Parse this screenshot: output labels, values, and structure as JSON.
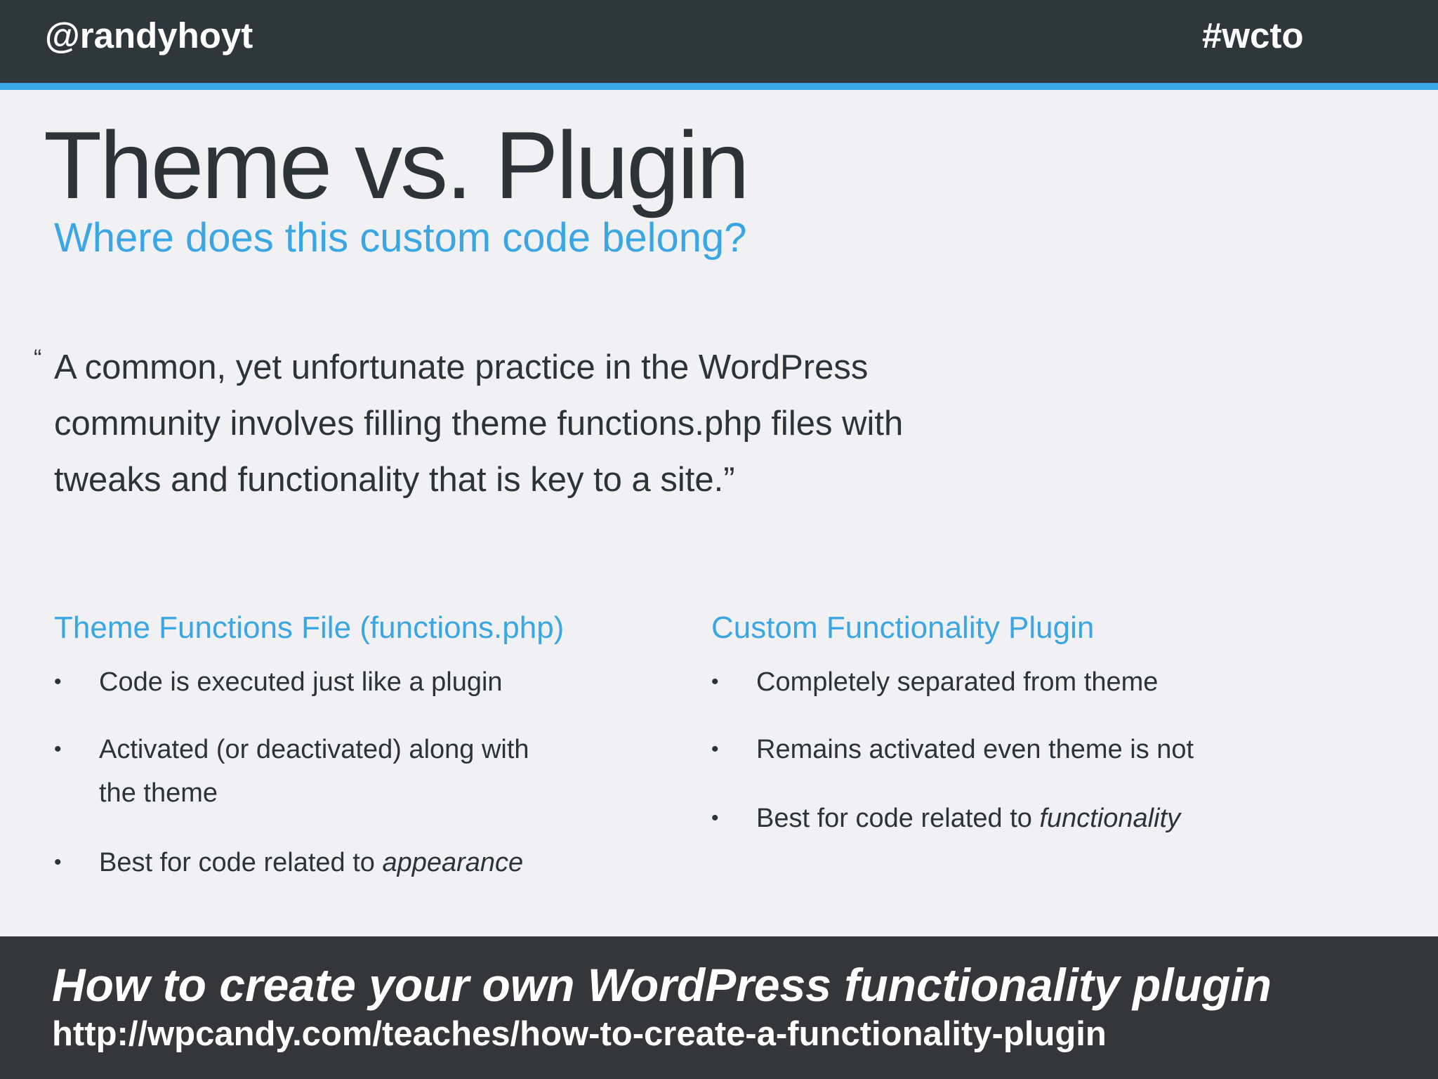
{
  "header": {
    "handle": "@randyhoyt",
    "hashtag": "#wcto"
  },
  "slide": {
    "title": "Theme vs. Plugin",
    "subtitle": "Where does this custom code belong?",
    "quote_open": "“",
    "quote_lines": [
      "A common, yet unfortunate practice in the WordPress",
      "community involves filling theme functions.php files with",
      "tweaks and functionality that is key to a site.”"
    ]
  },
  "columns": {
    "left": {
      "heading": "Theme Functions File (functions.php)",
      "bullets": [
        {
          "text": "Code is executed just like a plugin"
        },
        {
          "line1": "Activated (or deactivated) along with",
          "line2": "the theme"
        },
        {
          "prefix": "Best for code related to ",
          "emphasis": "appearance"
        }
      ]
    },
    "right": {
      "heading": "Custom Functionality Plugin",
      "bullets": [
        {
          "text": "Completely separated from theme"
        },
        {
          "text": "Remains activated even theme is not"
        },
        {
          "prefix": "Best for code related to ",
          "emphasis": "functionality"
        }
      ]
    }
  },
  "bullet_symbol": "•",
  "footer": {
    "title": "How to create your own WordPress functionality plugin",
    "url": "http://wpcandy.com/teaches/how-to-create-a-functionality-plugin"
  },
  "colors": {
    "header_bg": "#2e373c",
    "accent": "#3aa6e3",
    "body_bg": "#f1f1f4",
    "text": "#2d3439",
    "footer_bg": "#35363a"
  }
}
